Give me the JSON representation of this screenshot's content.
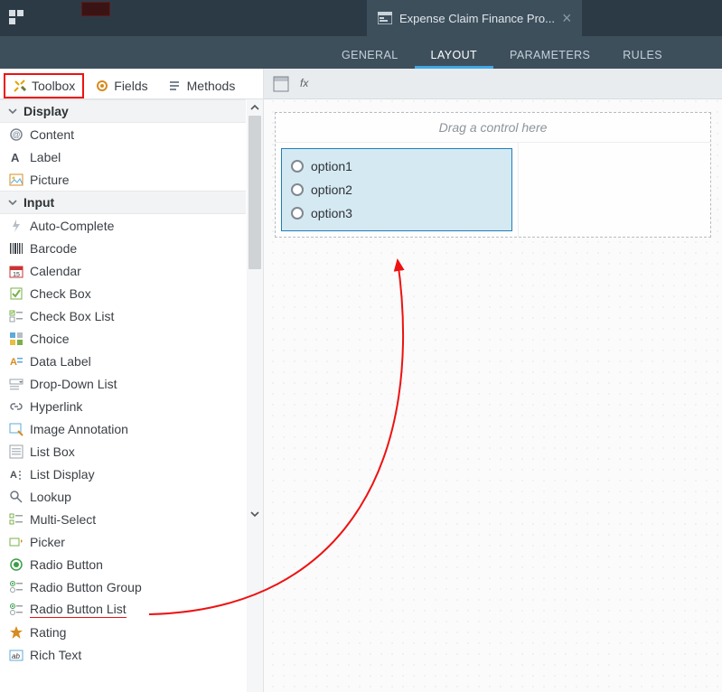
{
  "header": {
    "file_tab_title": "Expense Claim Finance Pro..."
  },
  "subnav": {
    "general": "GENERAL",
    "layout": "LAYOUT",
    "parameters": "PARAMETERS",
    "rules": "RULES"
  },
  "panel_tabs": {
    "toolbox": "Toolbox",
    "fields": "Fields",
    "methods": "Methods"
  },
  "groups": {
    "display": "Display",
    "input": "Input"
  },
  "display_items": {
    "content": "Content",
    "label": "Label",
    "picture": "Picture"
  },
  "input_items": {
    "auto_complete": "Auto-Complete",
    "barcode": "Barcode",
    "calendar": "Calendar",
    "check_box": "Check Box",
    "check_box_list": "Check Box List",
    "choice": "Choice",
    "data_label": "Data Label",
    "drop_down_list": "Drop-Down List",
    "hyperlink": "Hyperlink",
    "image_annotation": "Image Annotation",
    "list_box": "List Box",
    "list_display": "List Display",
    "lookup": "Lookup",
    "multi_select": "Multi-Select",
    "picker": "Picker",
    "radio_button": "Radio Button",
    "radio_button_group": "Radio Button Group",
    "radio_button_list": "Radio Button List",
    "rating": "Rating",
    "rich_text": "Rich Text"
  },
  "canvas": {
    "drop_hint": "Drag a control here",
    "options": {
      "o1": "option1",
      "o2": "option2",
      "o3": "option3"
    }
  }
}
